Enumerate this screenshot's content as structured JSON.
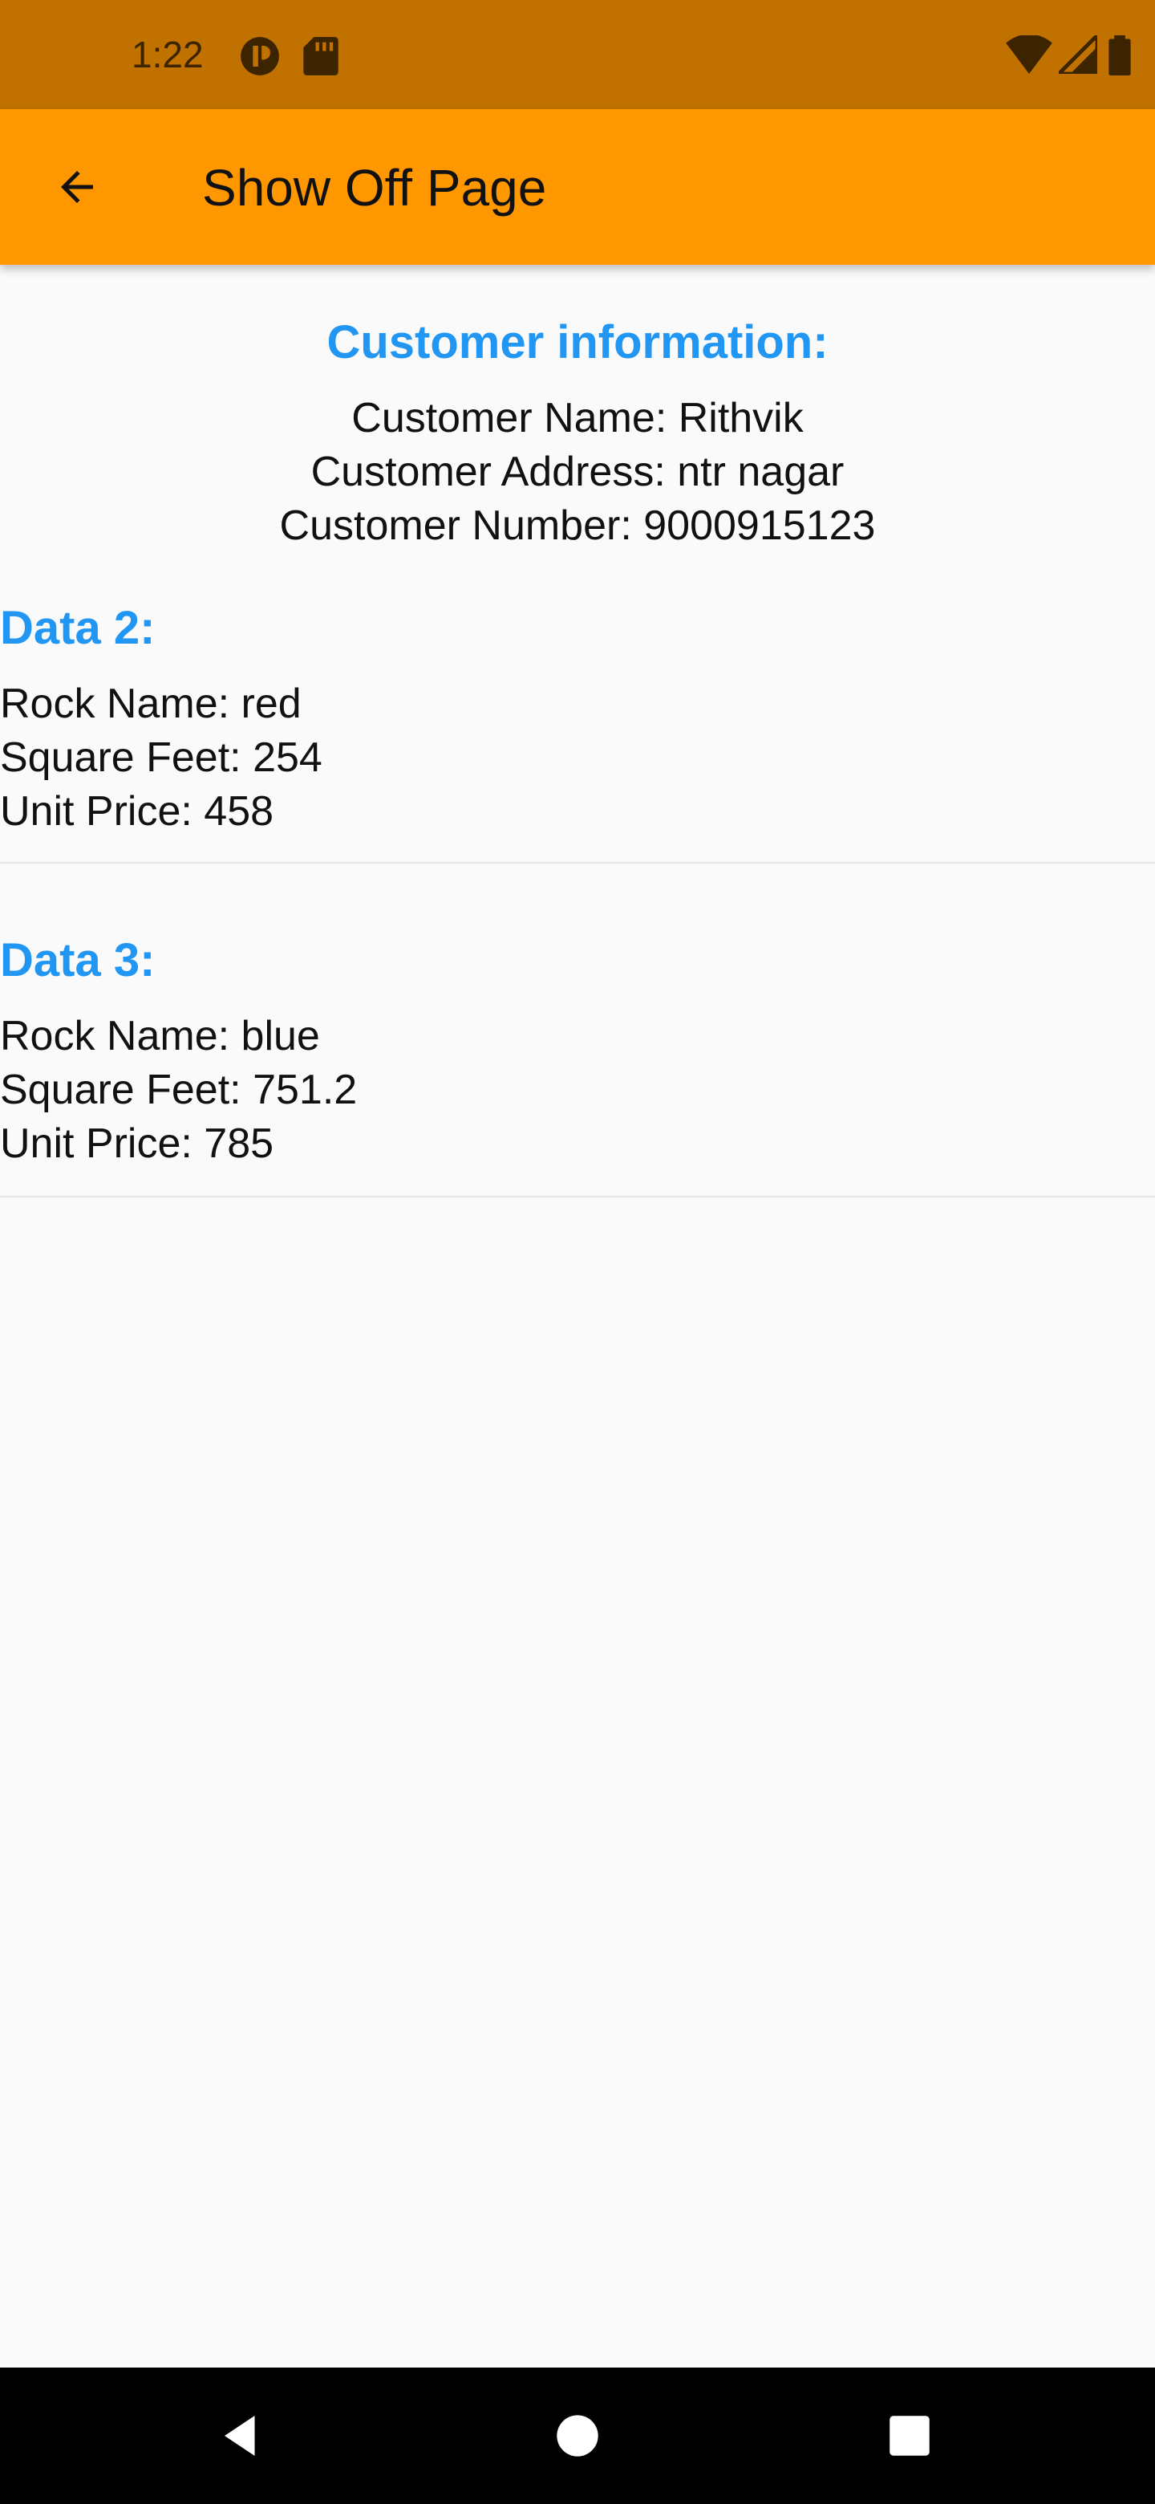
{
  "status_bar": {
    "time": "1:22"
  },
  "app_bar": {
    "title": "Show Off Page",
    "back_icon": "arrow-back-icon"
  },
  "customer": {
    "heading": "Customer information:",
    "name_line": "Customer Name: Rithvik",
    "address_line": "Customer Address: ntr nagar",
    "number_line": "Customer Number: 9000915123"
  },
  "data_items": [
    {
      "heading": "Data 2:",
      "rock_line": "Rock Name: red",
      "sqft_line": "Square Feet: 254",
      "price_line": "Unit Price: 458"
    },
    {
      "heading": "Data 3:",
      "rock_line": "Rock Name: blue",
      "sqft_line": "Square Feet: 751.2",
      "price_line": "Unit Price: 785"
    }
  ],
  "colors": {
    "status_bar": "#c17100",
    "app_bar": "#ff9800",
    "heading_blue": "#2196f3",
    "background": "#fafafa"
  }
}
